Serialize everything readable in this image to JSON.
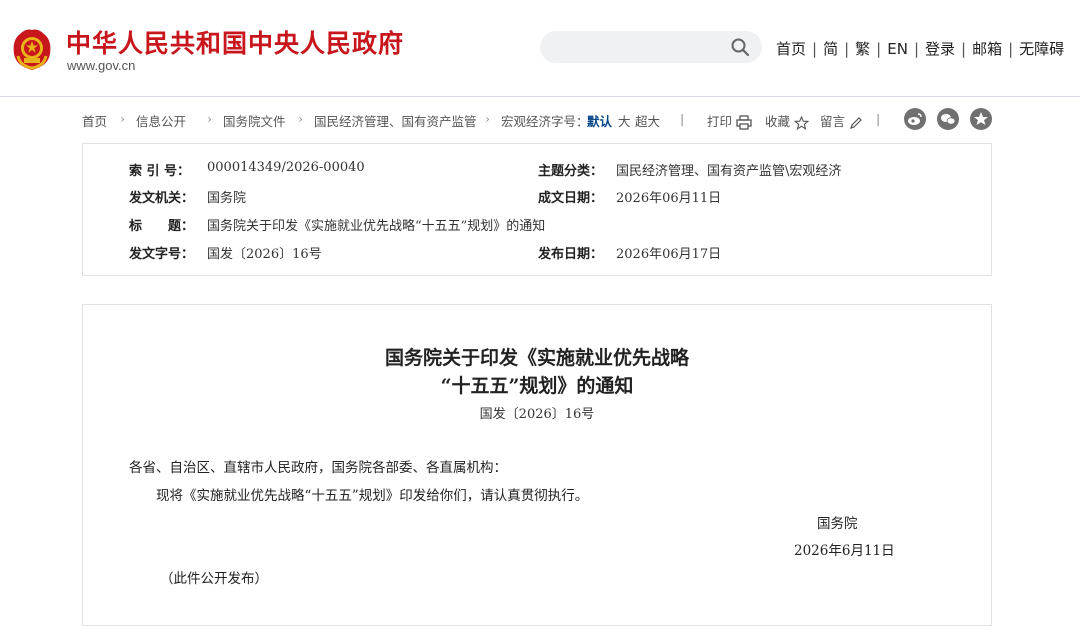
{
  "header": {
    "site_title": "中华人民共和国中央人民政府",
    "site_url": "www.gov.cn",
    "search_placeholder": "",
    "nav": [
      "首页",
      "简",
      "繁",
      "EN",
      "登录",
      "邮箱",
      "无障碍"
    ]
  },
  "breadcrumb": {
    "items": [
      "首页",
      "信息公开",
      "国务院文件",
      "国民经济管理、国有资产监管",
      "宏观经济字号："
    ],
    "font_sizes": [
      "默认",
      "大",
      "超大"
    ],
    "tools": [
      "打印",
      "收藏",
      "留言"
    ],
    "social_icons": [
      "weibo-icon",
      "wechat-icon",
      "star-icon"
    ]
  },
  "info": {
    "index_label": "索 引 号：",
    "index_value": "000014349/2026-00040",
    "category_label": "主题分类：",
    "category_value": "国民经济管理、国有资产监管\\宏观经济",
    "issuer_label": "发文机关：",
    "issuer_value": "国务院",
    "created_label": "成文日期：",
    "created_value": "2026年06月11日",
    "title_label": "标　　题：",
    "title_value": "国务院关于印发《实施就业优先战略“十五五”规划》的通知",
    "docno_label": "发文字号：",
    "docno_value": "国发〔2026〕16号",
    "published_label": "发布日期：",
    "published_value": "2026年06月17日"
  },
  "document": {
    "title_line1": "国务院关于印发《实施就业优先战略",
    "title_line2": "“十五五”规划》的通知",
    "doc_number": "国发〔2026〕16号",
    "salutation": "各省、自治区、直辖市人民政府，国务院各部委、各直属机构：",
    "body": "现将《实施就业优先战略“十五五”规划》印发给你们，请认真贯彻执行。",
    "signature": "国务院",
    "date": "2026年6月11日",
    "note": "（此件公开发布）"
  },
  "colors": {
    "brand_red": "#c8161d",
    "link_blue": "#0a4a8a",
    "border": "#dfe3e8"
  }
}
